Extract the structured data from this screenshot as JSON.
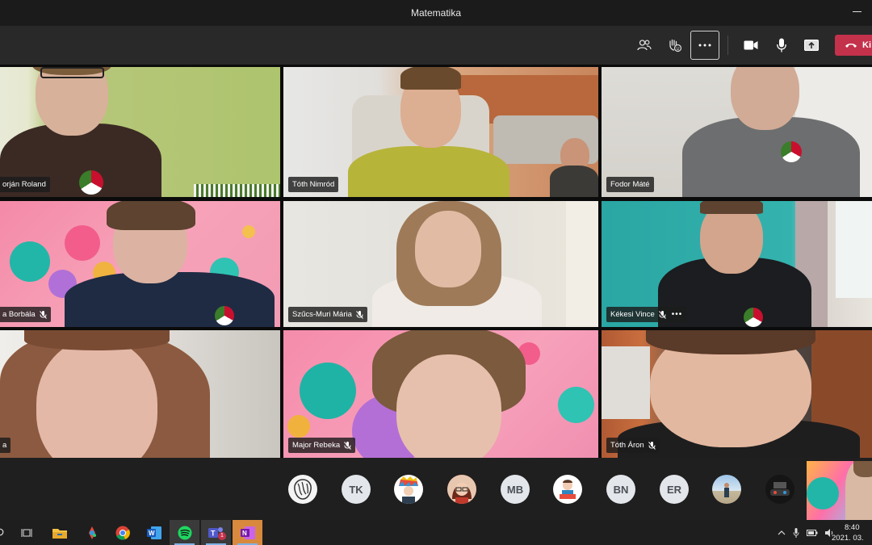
{
  "window": {
    "title": "Matematika"
  },
  "toolbar": {
    "leave_label": "Ki",
    "buttons": [
      "people-icon",
      "reactions-icon",
      "more-options-icon",
      "camera-icon",
      "mic-icon",
      "share-screen-icon"
    ]
  },
  "tiles": [
    {
      "name": "orján Roland",
      "muted": false
    },
    {
      "name": "Tóth Nimród",
      "muted": false
    },
    {
      "name": "Fodor Máté",
      "muted": false
    },
    {
      "name": "a Borbála",
      "muted": true
    },
    {
      "name": "Szűcs-Muri Mária",
      "muted": true
    },
    {
      "name": "Kékesi Vince",
      "muted": true
    },
    {
      "name": "a",
      "muted": false
    },
    {
      "name": "Major Rebeka",
      "muted": true
    },
    {
      "name": "Tóth Áron",
      "muted": true
    }
  ],
  "participants": [
    {
      "type": "image",
      "icon": "lion-avatar-icon"
    },
    {
      "type": "initials",
      "text": "TK"
    },
    {
      "type": "image",
      "icon": "colorful-hair-avatar-icon"
    },
    {
      "type": "image",
      "icon": "girl-cartoon-avatar-icon"
    },
    {
      "type": "initials",
      "text": "MB"
    },
    {
      "type": "image",
      "icon": "reading-cartoon-avatar-icon"
    },
    {
      "type": "initials",
      "text": "BN"
    },
    {
      "type": "initials",
      "text": "ER"
    },
    {
      "type": "image",
      "icon": "beach-photo-avatar-icon"
    },
    {
      "type": "image",
      "icon": "gaming-avatar-icon"
    }
  ],
  "taskbar": {
    "apps": [
      "task-view-icon",
      "file-explorer-icon",
      "paint-icon",
      "chrome-icon",
      "word-icon",
      "spotify-icon",
      "teams-icon",
      "onenote-icon"
    ],
    "teams_badge": "1",
    "time": "8:40",
    "date": "2021. 03."
  },
  "colors": {
    "leave": "#c4314b",
    "toolbar": "#292929",
    "titlebar": "#1b1b1b"
  }
}
